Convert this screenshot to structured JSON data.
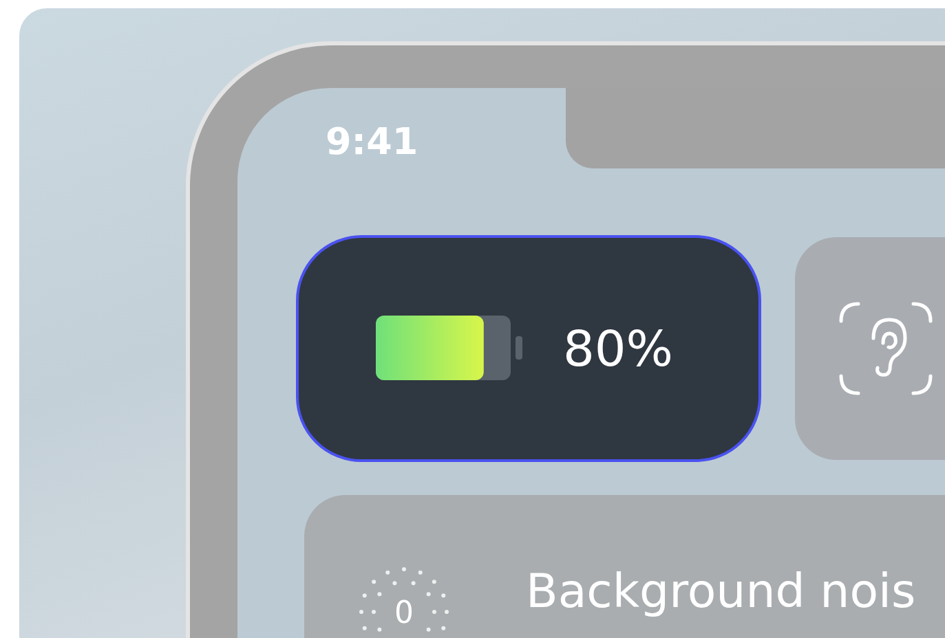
{
  "status_bar": {
    "time": "9:41"
  },
  "battery_tile": {
    "selected": true,
    "level": 0.8,
    "reading": "80%"
  },
  "hearing_tile": {
    "selected": false
  },
  "noise_card": {
    "title": "Background nois",
    "icon_text": "0"
  }
}
